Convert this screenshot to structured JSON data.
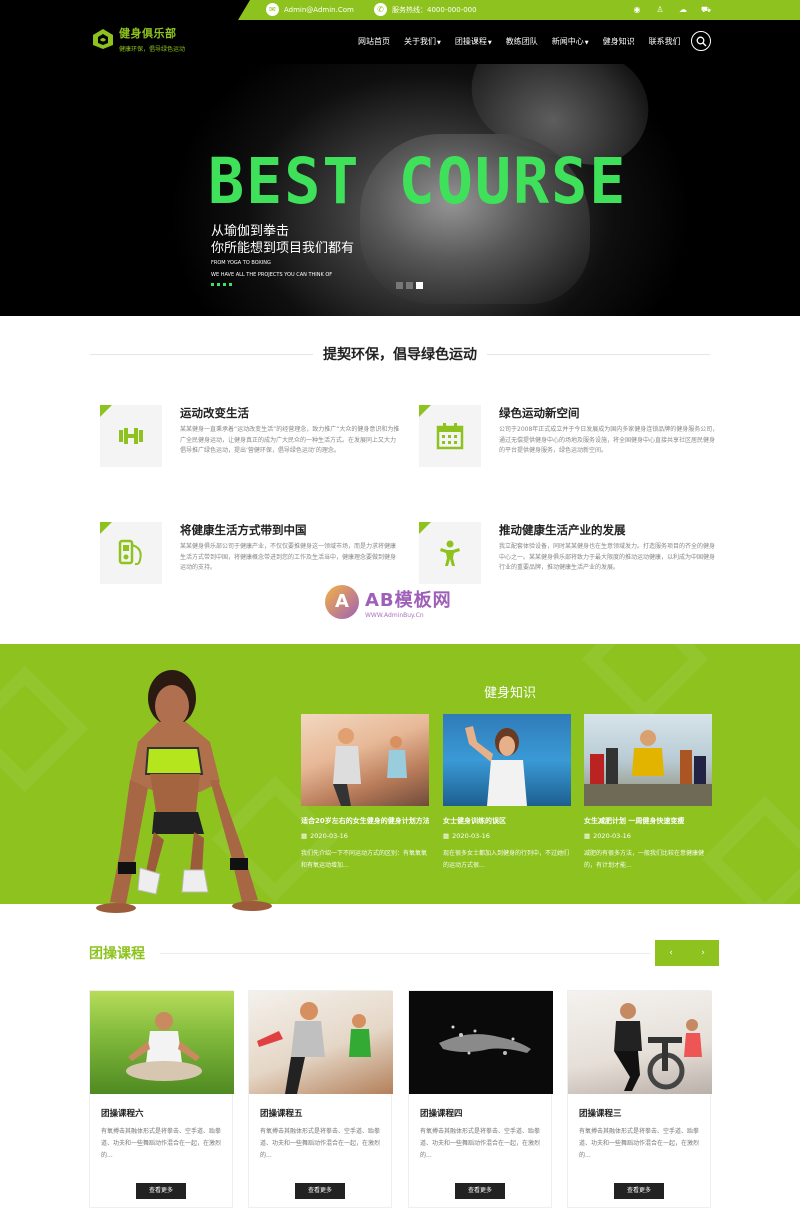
{
  "topbar": {
    "email": "Admin@Admin.Com",
    "phone": "服务热线：4000-000-000",
    "social_icons": [
      "weibo-icon",
      "qq-icon",
      "wechat-icon",
      "cart-icon"
    ]
  },
  "header": {
    "logo_title": "健身俱乐部",
    "logo_slogan": "健康环保，倡导绿色运动",
    "nav": [
      {
        "label": "网站首页",
        "dropdown": false
      },
      {
        "label": "关于我们",
        "dropdown": true
      },
      {
        "label": "团操课程",
        "dropdown": true
      },
      {
        "label": "教练团队",
        "dropdown": false
      },
      {
        "label": "新闻中心",
        "dropdown": true
      },
      {
        "label": "健身知识",
        "dropdown": false
      },
      {
        "label": "联系我们",
        "dropdown": false
      }
    ]
  },
  "hero": {
    "title": "BEST COURSE",
    "line1": "从瑜伽到拳击",
    "line2": "你所能想到项目我们都有",
    "en1": "FROM YOGA TO BOXING",
    "en2": "WE HAVE ALL THE PROJECTS YOU CAN THINK OF",
    "slides": 3,
    "active_slide": 3
  },
  "features": {
    "title": "提契环保，倡导绿色运动",
    "items": [
      {
        "icon": "dumbbell-icon",
        "title": "运动改变生活",
        "text": "某某健身一直秉承着“运动改变生活”的经营理念，致力推广“大众的健身意识和为推广全民健身运动，让健身真正的成为广大民众的一种生活方式。在发展同上又大力倡导推广绿色运动，提出‘营健环保，倡导绿色运动’的理念。"
      },
      {
        "icon": "calendar-icon",
        "title": "绿色运动新空间",
        "text": "公司于2008年正式成立并于今日发展成为国内多家健身连锁品牌的健身服务公司，通过无偿提供健身中心的场地及服务设施，将全国健身中心直接共享社区居民健身的平台提供健身服务，绿色运动新空间。"
      },
      {
        "icon": "mp3-icon",
        "title": "将健康生活方式带到中国",
        "text": "某某健身俱乐部公司于健康产业，不仅仅要推健身这一领域市场，而是力求将健康生活方式带到中国，将健康概念带进到您的工作及生活当中，健康理念要做到健身运动的支持。"
      },
      {
        "icon": "fitness-person-icon",
        "title": "推动健康生活产业的发展",
        "text": "我立配套体验设备，同时某某健身也在生意领域发力。打造服务项目的齐全的健身中心之一。某某健身俱乐部将致力于最大限度的推动运动健康，以利成为中国健身行业的重要品牌，推动健康生活产业的发展。"
      }
    ]
  },
  "watermark": {
    "brand": "AB模板网",
    "url": "WWW.AdminBuy.Cn",
    "letter": "A"
  },
  "knowledge": {
    "title": "健身知识",
    "items": [
      {
        "title": "适合20岁左右的女生健身的健身计划方法",
        "date": "2020-03-16",
        "excerpt": "我们先介绍一下不同运动方式的区别：有氧氧氧和有氧运动增加..."
      },
      {
        "title": "女士健身训练的误区",
        "date": "2020-03-16",
        "excerpt": "现在很多女士都加入到健身的行列中，不过她们的运动方式很..."
      },
      {
        "title": "女生减肥计划 一周健身快速变瘦",
        "date": "2020-03-16",
        "excerpt": "减肥的有很多方法，一般我们比较在意健康健的，有计划才能..."
      }
    ]
  },
  "courses": {
    "title": "团操课程",
    "prev": "‹",
    "next": "›",
    "more_label": "查看更多",
    "items": [
      {
        "title": "团操课程六",
        "text": "有氧搏击其融体形式是将拳击、空手道、跆拳道、功夫和一些舞蹈动作混合在一起，在激烈的..."
      },
      {
        "title": "团操课程五",
        "text": "有氧搏击其融体形式是将拳击、空手道、跆拳道、功夫和一些舞蹈动作混合在一起，在激烈的..."
      },
      {
        "title": "团操课程四",
        "text": "有氧搏击其融体形式是将拳击、空手道、跆拳道、功夫和一些舞蹈动作混合在一起，在激烈的..."
      },
      {
        "title": "团操课程三",
        "text": "有氧搏击其融体形式是将拳击、空手道、跆拳道、功夫和一些舞蹈动作混合在一起，在激烈的..."
      }
    ]
  },
  "colors": {
    "brand_green": "#8dc21f",
    "hero_green": "#3fe15a",
    "dark": "#000000"
  }
}
